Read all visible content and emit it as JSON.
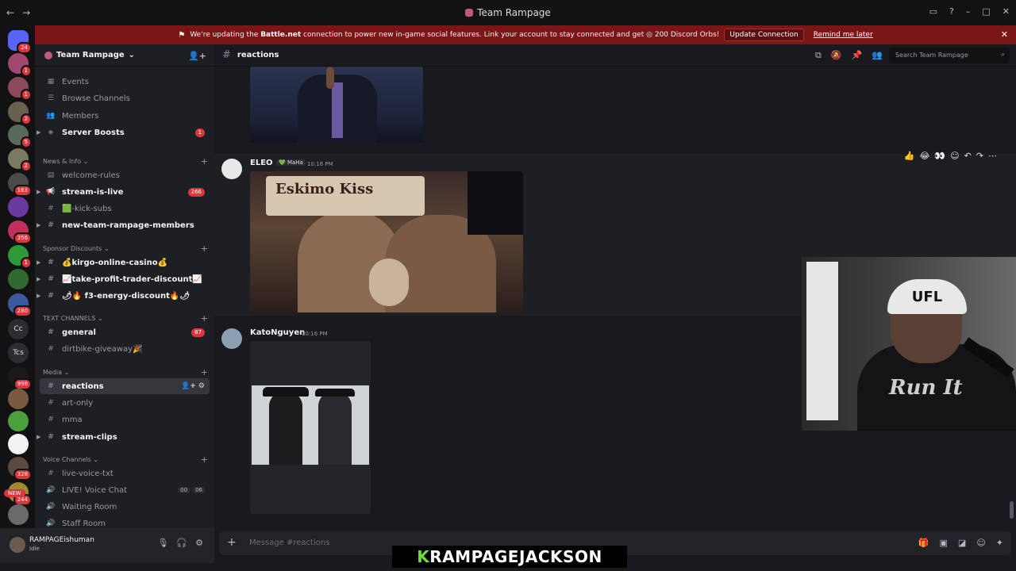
{
  "window": {
    "title": "Team Rampage",
    "back": "←",
    "forward": "→",
    "controls": [
      "▭",
      "?",
      "–",
      "□",
      "✕"
    ]
  },
  "banner": {
    "icon": "⚑",
    "text_pre": "We're updating the ",
    "text_bold": "Battle.net",
    "text_post": " connection to power new in-game social features. Link your account to stay connected and get ",
    "orb_text": "◎ 200 Discord Orbs!",
    "update_button": "Update Connection",
    "later_link": "Remind me later",
    "close": "✕"
  },
  "servers": [
    {
      "label": "",
      "badge": "24",
      "color": "#5865f2"
    },
    {
      "label": "",
      "badge": "1",
      "color": "#a04870"
    },
    {
      "label": "",
      "badge": "1",
      "color": "#8a4a5a"
    },
    {
      "label": "",
      "badge": "2",
      "color": "#6a6050"
    },
    {
      "label": "",
      "badge": "5",
      "color": "#5a6a5a"
    },
    {
      "label": "",
      "badge": "2",
      "color": "#7a7a60"
    },
    {
      "label": "",
      "badge": "163",
      "color": "#4a4a4a"
    },
    {
      "label": "",
      "badge": "",
      "color": "#6a3aa0"
    },
    {
      "label": "",
      "badge": "356",
      "color": "#c0305a"
    },
    {
      "label": "",
      "badge": "1",
      "color": "#2a9a3a"
    },
    {
      "label": "",
      "badge": "",
      "color": "#306a30"
    },
    {
      "label": "",
      "badge": "280",
      "color": "#3a5aa0"
    },
    {
      "label": "Cc",
      "badge": "",
      "color": "#2b2d31"
    },
    {
      "label": "Tcs",
      "badge": "",
      "color": "#2b2d31"
    },
    {
      "label": "",
      "badge": "998",
      "color": "#1a1a1a"
    },
    {
      "label": "",
      "badge": "",
      "color": "#7a5a40"
    },
    {
      "label": "",
      "badge": "",
      "color": "#4aa03a"
    },
    {
      "label": "",
      "badge": "",
      "color": "#f2f3f5"
    },
    {
      "label": "",
      "badge": "328",
      "color": "#5a4a40"
    },
    {
      "label": "",
      "badge": "244",
      "color": "#a08a30"
    },
    {
      "label": "",
      "badge": "",
      "color": "#6a6a6a"
    }
  ],
  "new_badge": "NEW",
  "server_header": {
    "name": "Team Rampage",
    "chevron": "⌄",
    "invite": "👤+"
  },
  "nav": {
    "events": "Events",
    "browse": "Browse Channels",
    "members": "Members",
    "boosts": "Server Boosts",
    "boosts_count": "1"
  },
  "categories": {
    "news": "News & Info ⌄",
    "sponsor": "Sponsor Discounts ⌄",
    "text": "TEXT CHANNELS ⌄",
    "media": "Media ⌄",
    "voice": "Voice Channels ⌄"
  },
  "channels": {
    "welcome": "welcome-rules",
    "stream_live": "stream-is-live",
    "stream_live_count": "266",
    "kick": "🟩-kick-subs",
    "new_members": "new-team-rampage-members",
    "kirgo": "💰kirgo-online-casino💰",
    "take_profit": "📈take-profit-trader-discount📈",
    "f3": "🌶🔥 f3-energy-discount🔥🌶",
    "general": "general",
    "general_count": "87",
    "dirtbike": "dirtbike-giveaway🎉",
    "reactions": "reactions",
    "art": "art-only",
    "mma": "mma",
    "clips": "stream-clips",
    "live_voice_txt": "live-voice-txt",
    "live_voice": "LIVE! Voice Chat",
    "vc_a": "00",
    "vc_b": "06",
    "waiting": "Waiting Room",
    "staff": "Staff Room"
  },
  "user": {
    "name": "RAMPAGEishuman",
    "status": "Idle"
  },
  "channel_header": {
    "hash": "#",
    "name": "reactions",
    "search_placeholder": "Search Team Rampage"
  },
  "messages": [
    {
      "author": "ELEO",
      "tag": "💚 MaHa",
      "time": "10:16 PM",
      "gif_text": "Eskimo Kiss"
    },
    {
      "author": "KatoNguyen",
      "time": "10:16 PM"
    }
  ],
  "composer": {
    "placeholder": "Message #reactions"
  },
  "webcam": {
    "cap_text": "UFL",
    "shirt_text": "Run It"
  },
  "streamer_name": {
    "first": "K",
    "rest": "RAMPAGEJACKSON"
  }
}
